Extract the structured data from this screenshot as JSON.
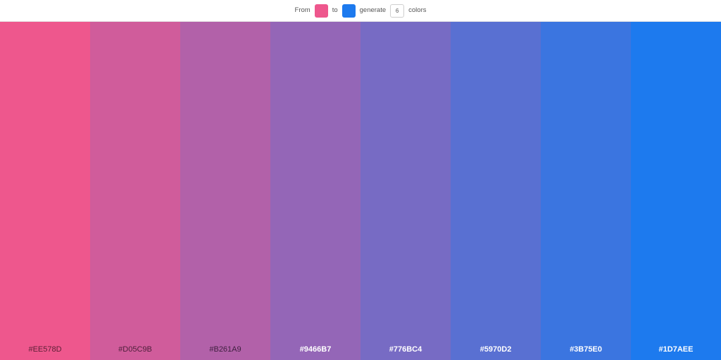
{
  "toolbar": {
    "from_label": "From",
    "from_color": "#EE578D",
    "to_label": "to",
    "to_color": "#1D7AEE",
    "generate_label": "generate",
    "count_value": "6",
    "colors_label": "colors"
  },
  "palette": {
    "stripes": [
      {
        "hex": "#EE578D",
        "color": "#EE578D",
        "text_color": "#5a1f35",
        "bold": false
      },
      {
        "hex": "#D05C9B",
        "color": "#D05C9B",
        "text_color": "#4c1f3a",
        "bold": false
      },
      {
        "hex": "#B261A9",
        "color": "#B261A9",
        "text_color": "#3f2040",
        "bold": false
      },
      {
        "hex": "#9466B7",
        "color": "#9466B7",
        "text_color": "#ffffff",
        "bold": true
      },
      {
        "hex": "#776BC4",
        "color": "#776BC4",
        "text_color": "#ffffff",
        "bold": true
      },
      {
        "hex": "#5970D2",
        "color": "#5970D2",
        "text_color": "#ffffff",
        "bold": true
      },
      {
        "hex": "#3B75E0",
        "color": "#3B75E0",
        "text_color": "#ffffff",
        "bold": true
      },
      {
        "hex": "#1D7AEE",
        "color": "#1D7AEE",
        "text_color": "#ffffff",
        "bold": true
      }
    ]
  }
}
